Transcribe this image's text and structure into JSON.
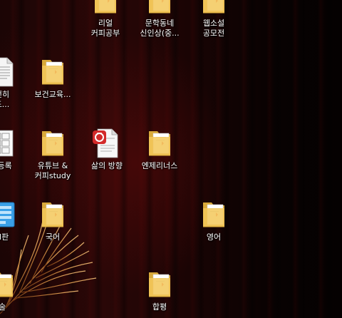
{
  "desktop": {
    "icons": [
      {
        "id": "real-coffee",
        "label": "리얼\n커피공부",
        "type": "folder"
      },
      {
        "id": "munhak",
        "label": "문학동네\n신인상(중...",
        "type": "folder"
      },
      {
        "id": "websoseol",
        "label": "웹소설\n공모전",
        "type": "folder"
      },
      {
        "id": "left1",
        "label": "번히\n도...",
        "type": "document"
      },
      {
        "id": "health-edu",
        "label": "보건교육...",
        "type": "folder"
      },
      {
        "id": "left2",
        "label": "| 등록",
        "type": "spreadsheet"
      },
      {
        "id": "youtube-coffee",
        "label": "유튜브 &\n커피study",
        "type": "folder"
      },
      {
        "id": "life-direction",
        "label": "삶의 방향",
        "type": "hwp-document"
      },
      {
        "id": "ncs",
        "label": "엔제리너스",
        "type": "folder"
      },
      {
        "id": "left3",
        "label": "H판",
        "type": "app"
      },
      {
        "id": "korean",
        "label": "국어",
        "type": "folder"
      },
      {
        "id": "english",
        "label": "영어",
        "type": "folder"
      },
      {
        "id": "left4",
        "label": "술",
        "type": "folder"
      },
      {
        "id": "hapyeong",
        "label": "합평",
        "type": "folder"
      }
    ]
  },
  "colors": {
    "folder": "#f3c85a",
    "folder_dark": "#d9a93a",
    "hwp_red": "#d32a2a",
    "app_blue": "#3aa0e8"
  }
}
